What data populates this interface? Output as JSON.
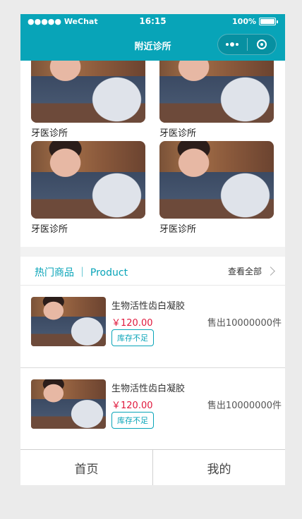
{
  "status": {
    "carrier": "●●●●● WeChat",
    "wifi": "wifi-icon",
    "time": "16:15",
    "battery": "100%"
  },
  "nav": {
    "title": "附近诊所",
    "more": "more-icon",
    "close": "target-icon"
  },
  "clinics": [
    {
      "name": "牙医诊所"
    },
    {
      "name": "牙医诊所"
    },
    {
      "name": "牙医诊所"
    },
    {
      "name": "牙医诊所"
    }
  ],
  "hot": {
    "title": "热门商品 ｜ Product",
    "more": "查看全部"
  },
  "products": [
    {
      "name": "生物活性齿白凝胶",
      "price": "￥120.00",
      "sold": "售出10000000件",
      "stock": "库存不足"
    },
    {
      "name": "生物活性齿白凝胶",
      "price": "￥120.00",
      "sold": "售出10000000件",
      "stock": "库存不足"
    }
  ],
  "tabs": [
    {
      "label": "首页"
    },
    {
      "label": "我的"
    }
  ]
}
